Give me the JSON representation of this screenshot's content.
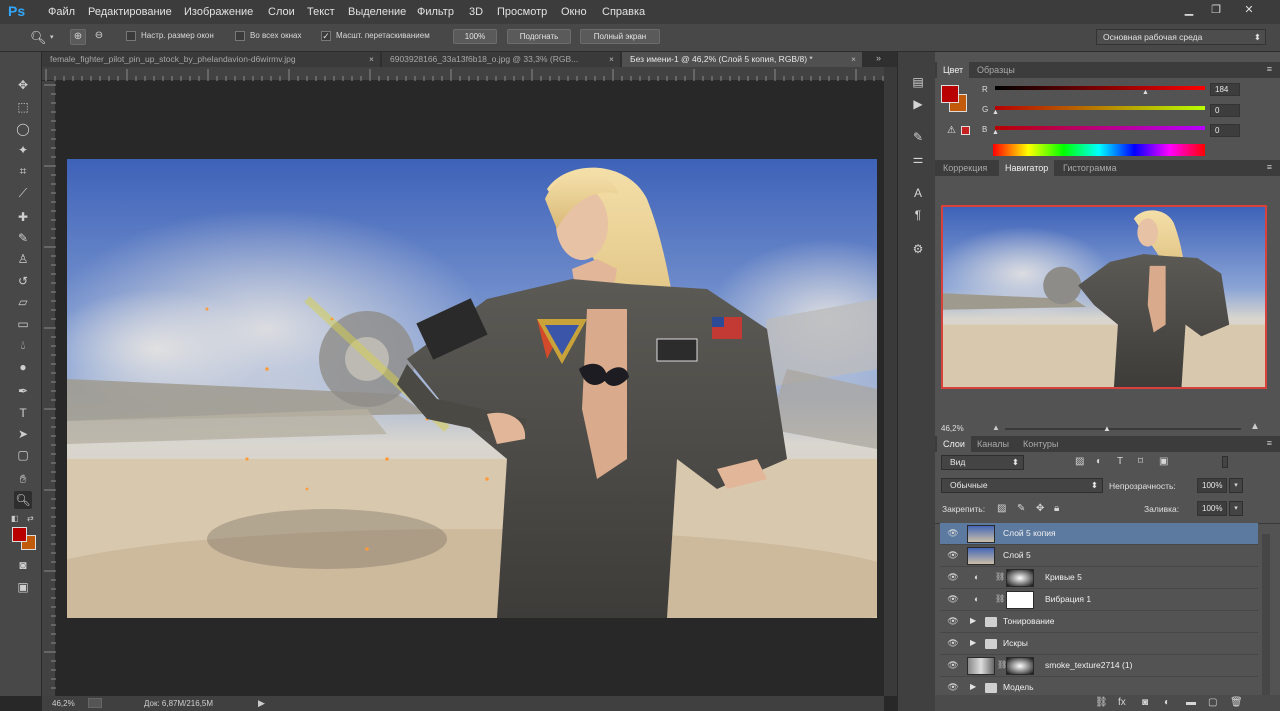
{
  "app": {
    "logo": "Ps"
  },
  "menu": [
    "Файл",
    "Редактирование",
    "Изображение",
    "Слои",
    "Текст",
    "Выделение",
    "Фильтр",
    "3D",
    "Просмотр",
    "Окно",
    "Справка"
  ],
  "window_controls": {
    "minimize": "▁",
    "restore": "❐",
    "close": "✕"
  },
  "options": {
    "resize_windows": "Настр. размер окон",
    "all_windows": "Во всех окнах",
    "scrubby_zoom": "Масшт. перетаскиванием",
    "zoom_100": "100%",
    "fit": "Подогнать",
    "fullscreen": "Полный экран",
    "workspace": "Основная рабочая среда"
  },
  "tabs": [
    {
      "label": "female_fighter_pilot_pin_up_stock_by_phelandavion-d6wirmv.jpg",
      "close": "×"
    },
    {
      "label": "6903928166_33a13f6b18_o.jpg @ 33,3% (RGB...",
      "close": "×"
    },
    {
      "label": "Без имени-1 @ 46,2% (Слой 5 копия, RGB/8) *",
      "close": "×"
    }
  ],
  "status": {
    "zoom": "46,2%",
    "doc": "Док: 6,87M/216,5M"
  },
  "color_panel": {
    "tabs": [
      "Цвет",
      "Образцы"
    ],
    "r_label": "R",
    "g_label": "G",
    "b_label": "B",
    "r": "184",
    "g": "0",
    "b": "0",
    "fg_color": "#b80000",
    "bg_color": "#c15a0a"
  },
  "navigator": {
    "tabs": [
      "Коррекция",
      "Навигатор",
      "Гистограмма"
    ],
    "zoom": "46,2%"
  },
  "layers": {
    "tabs": [
      "Слои",
      "Каналы",
      "Контуры"
    ],
    "filter": "Вид",
    "blend_mode": "Обычные",
    "opacity_label": "Непрозрачность:",
    "opacity": "100%",
    "lock_label": "Закрепить:",
    "fill_label": "Заливка:",
    "fill": "100%",
    "items": [
      {
        "name": "Слой 5 копия"
      },
      {
        "name": "Слой 5"
      },
      {
        "name": "Кривые 5"
      },
      {
        "name": "Вибрация 1"
      },
      {
        "name": "Тонирование"
      },
      {
        "name": "Искры"
      },
      {
        "name": "smoke_texture2714 (1)"
      },
      {
        "name": "Модель"
      }
    ]
  }
}
